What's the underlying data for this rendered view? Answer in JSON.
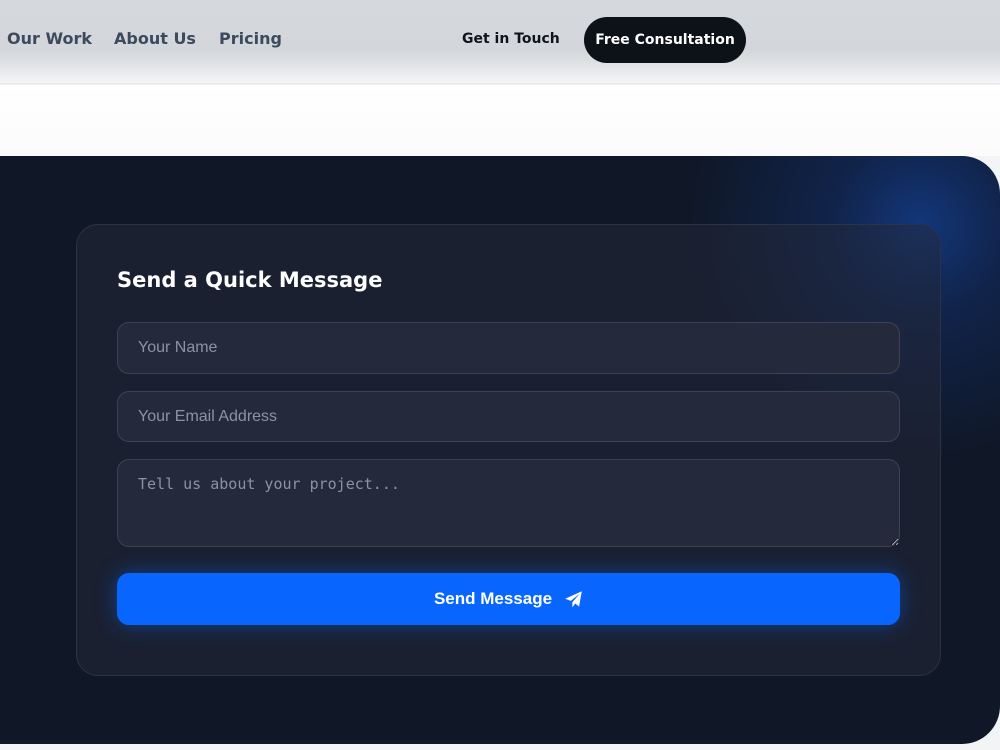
{
  "nav": {
    "links": [
      {
        "label": "Our Work"
      },
      {
        "label": "About Us"
      },
      {
        "label": "Pricing"
      }
    ],
    "get_in_touch": "Get in Touch",
    "cta": "Free Consultation"
  },
  "form": {
    "title": "Send a Quick Message",
    "name_placeholder": "Your Name",
    "email_placeholder": "Your Email Address",
    "message_placeholder": "Tell us about your project...",
    "submit_label": "Send Message",
    "submit_icon": "paper-plane-icon"
  },
  "colors": {
    "accent": "#0866ff",
    "section_bg": "#101828",
    "cta_bg": "#0d1118"
  }
}
